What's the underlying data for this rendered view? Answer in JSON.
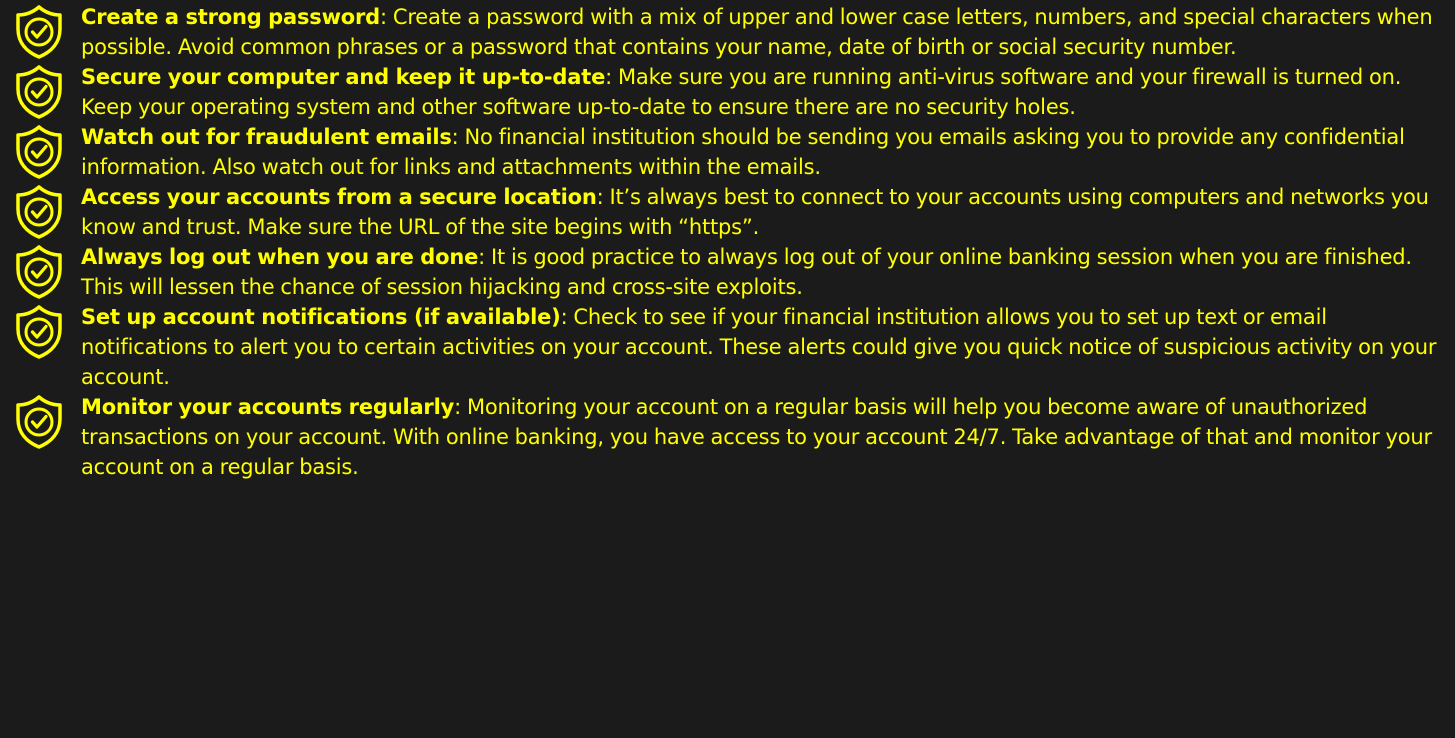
{
  "tips": [
    {
      "icon": "shield-check-icon",
      "title": "Create a strong password",
      "separator": ":",
      "text": " Create a password with a mix of upper and lower case letters, numbers, and special characters when possible. Avoid common phrases or a password that contains your name, date of birth or social security number."
    },
    {
      "icon": "shield-check-icon",
      "title": "Secure your computer and keep it up-to-date",
      "separator": ":",
      "text": " Make sure you are running anti-virus software and your firewall is turned on. Keep your operating system and other software up-to-date to ensure there are no security holes."
    },
    {
      "icon": "shield-check-icon",
      "title": "Watch out for fraudulent emails",
      "separator": ":",
      "text": " No financial institution should be sending you emails asking you to provide any confidential information. Also watch out for links and attachments within the emails."
    },
    {
      "icon": "shield-check-icon",
      "title": "Access your accounts from a secure location",
      "separator": ":",
      "text": " It’s always best to connect to your accounts using computers and networks you know and trust. Make sure the URL of the site begins with “https”."
    },
    {
      "icon": "shield-check-icon",
      "title": "Always log out when you are done",
      "separator": ":",
      "text": " It is good practice to always log out of your online banking session when you are finished. This will lessen the chance of session hijacking and cross-site exploits."
    },
    {
      "icon": "shield-check-icon",
      "title": "Set up account notifications (if available)",
      "separator": ":",
      "text": " Check to see if your financial institution allows you to set up text or email notifications to alert you to certain activities on your account. These alerts could give you quick notice of suspicious activity on your account."
    },
    {
      "icon": "shield-check-icon",
      "title": "Monitor your accounts regularly",
      "separator": ":",
      "text": " Monitoring your account on a regular basis will help you become aware of unauthorized transactions on your account. With online banking, you have access to your account 24/7.  Take advantage of that and monitor your account on a regular basis."
    }
  ],
  "colors": {
    "background": "#1b1b1b",
    "accent": "#ffff00"
  }
}
